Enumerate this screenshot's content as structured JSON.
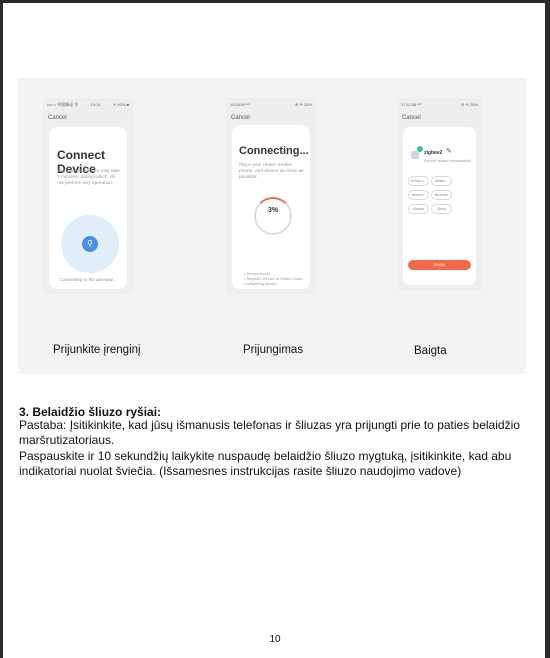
{
  "screens": [
    {
      "status_left": "•••○○ 中国移动 令",
      "status_time": "19:14",
      "status_right": "✈ 60% ■",
      "cancel": "Cancel",
      "title": "Connect Device",
      "description": "The search process may take 2 minutes, during which, do not perform any operation.",
      "progress_text": "Connecting to the gateway...",
      "icon": "search-icon"
    },
    {
      "status_left": "14:04:59 ⁴ᴳ",
      "status_right": "⊕ ✈ 28%",
      "cancel": "Cancel",
      "title": "Connecting...",
      "description": "Place your router, mobile phone, and device as close as possible",
      "percent": "3%",
      "progress": 0.03,
      "steps": [
        "Device found",
        "Register Device to Smart Cloud",
        "Initializing device..."
      ]
    },
    {
      "status_left": "17:11:58 ⁴ᴳ",
      "status_right": "⊕ ✈ 28%",
      "cancel": "Cancel",
      "device_name": "zigbee2",
      "device_subtitle": "Device added successfully",
      "rooms": [
        "Living ro...",
        "Master...",
        "Second...",
        "Bedroom",
        "Kitchen",
        "Study"
      ],
      "done": "Done"
    }
  ],
  "captions": [
    "Prijunkite įrenginį",
    "Prijungimas",
    "Baigta"
  ],
  "section_title": "3. Belaidžio šliuzo ryšiai:",
  "paragraph_1": "Pastaba: Įsitikinkite, kad jūsų išmanusis telefonas ir šliuzas yra prijungti prie to paties belaidžio maršrutizatoriaus.",
  "paragraph_2": "Paspauskite ir 10 sekundžių laikykite nuspaudę belaidžio šliuzo mygtuką, įsitikinkite, kad abu indikatoriai nuolat šviečia. (Išsamesnes instrukcijas rasite šliuzo naudojimo vadove)",
  "page_number": "10",
  "colors": {
    "accent": "#e8704a",
    "done_button": "#f06a4a",
    "search_blue": "#4a90e2",
    "success_green": "#42c28a"
  }
}
